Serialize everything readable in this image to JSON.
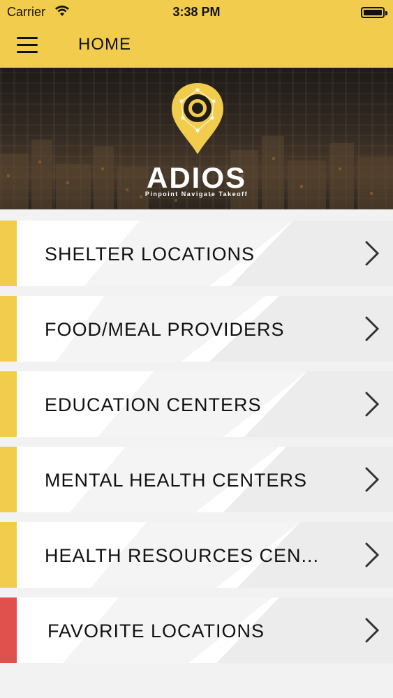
{
  "status_bar": {
    "carrier": "Carrier",
    "time": "3:38 PM",
    "wifi_icon": "wifi-icon",
    "battery_icon": "battery-icon"
  },
  "nav_bar": {
    "title": "HOME",
    "menu_icon": "hamburger-menu-icon",
    "background_color": "#f2cc4c"
  },
  "hero": {
    "brand": "ADIOS",
    "tagline": "Pinpoint Navigate Takeoff",
    "logo_icon": "location-pin-logo-icon"
  },
  "menu": {
    "items": [
      {
        "label": "SHELTER LOCATIONS",
        "accent": "#f2cc4c"
      },
      {
        "label": "FOOD/MEAL PROVIDERS",
        "accent": "#f2cc4c"
      },
      {
        "label": "EDUCATION CENTERS",
        "accent": "#f2cc4c"
      },
      {
        "label": "MENTAL HEALTH CENTERS",
        "accent": "#f2cc4c"
      },
      {
        "label": "HEALTH RESOURCES CEN...",
        "accent": "#f2cc4c"
      },
      {
        "label": "FAVORITE LOCATIONS",
        "accent": "#e0514e"
      }
    ],
    "chevron_icon": "chevron-right-icon"
  }
}
